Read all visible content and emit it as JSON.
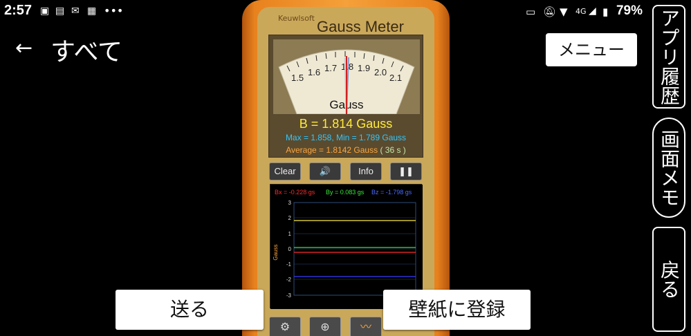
{
  "status_bar": {
    "time": "2:57",
    "network": "4G",
    "battery": "79%",
    "icons": [
      "notification-app-icon",
      "notification-phone-icon",
      "notification-mail-icon",
      "notification-video-icon",
      "more-notifications-icon"
    ]
  },
  "top_bar": {
    "back_icon": "←",
    "title": "すべて",
    "menu_label": "メニュー"
  },
  "side_panel": {
    "history_label": "アプリ履歴",
    "memo_label": "画面メモ",
    "back_label": "戻る"
  },
  "app": {
    "brand": "Keuwlsoft",
    "title": "Gauss Meter",
    "gauge_unit": "Gauss",
    "gauge_ticks": [
      "1.5",
      "1.6",
      "1.7",
      "1.8",
      "1.9",
      "2.0",
      "2.1"
    ],
    "reading_main": "B = 1.814 Gauss",
    "reading_minmax": "Max = 1.858,  Min = 1.789 Gauss",
    "reading_avg": "Average = 1.8142 Gauss",
    "reading_time": "( 36 s )",
    "buttons": {
      "clear": "Clear",
      "sound": "🔊",
      "info": "Info",
      "pause": "❚❚"
    },
    "graph": {
      "bx_label": "Bx = -0.228 gs",
      "by_label": "By = 0.083 gs",
      "bz_label": "Bz = -1.798 gs",
      "y_axis_label": "Gauss",
      "y_ticks": [
        "3",
        "2",
        "1",
        "0",
        "-1",
        "-2",
        "-3"
      ],
      "colors": {
        "bx": "#ff2a2a",
        "by": "#39e83a",
        "bz": "#3a3aff",
        "total": "#ffeb3b"
      }
    }
  },
  "overlay_buttons": {
    "send": "送る",
    "wallpaper": "壁紙に登録"
  }
}
